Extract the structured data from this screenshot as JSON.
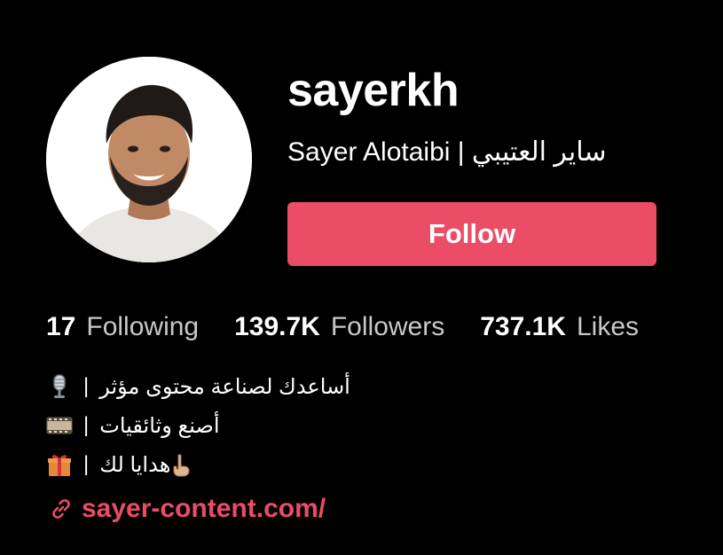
{
  "profile": {
    "username": "sayerkh",
    "display_name": "Sayer Alotaibi | ساير العتيبي",
    "follow_label": "Follow",
    "accent_color": "#ea4d65",
    "avatar_icon": "profile-photo"
  },
  "stats": [
    {
      "value": "17",
      "label": "Following"
    },
    {
      "value": "139.7K",
      "label": "Followers"
    },
    {
      "value": "737.1K",
      "label": "Likes"
    }
  ],
  "bio": {
    "lines": [
      {
        "icon": "microphone-icon",
        "separator": "|",
        "text": "أساعدك لصناعة محتوى مؤثر"
      },
      {
        "icon": "film-icon",
        "separator": "|",
        "text": "أصنع وثائقيات"
      },
      {
        "icon": "gift-icon",
        "separator": "|",
        "text": "هدايا لك",
        "trailing_icon": "pointing-down-icon"
      }
    ]
  },
  "link": {
    "icon": "link-icon",
    "text": "sayer-content.com/"
  }
}
